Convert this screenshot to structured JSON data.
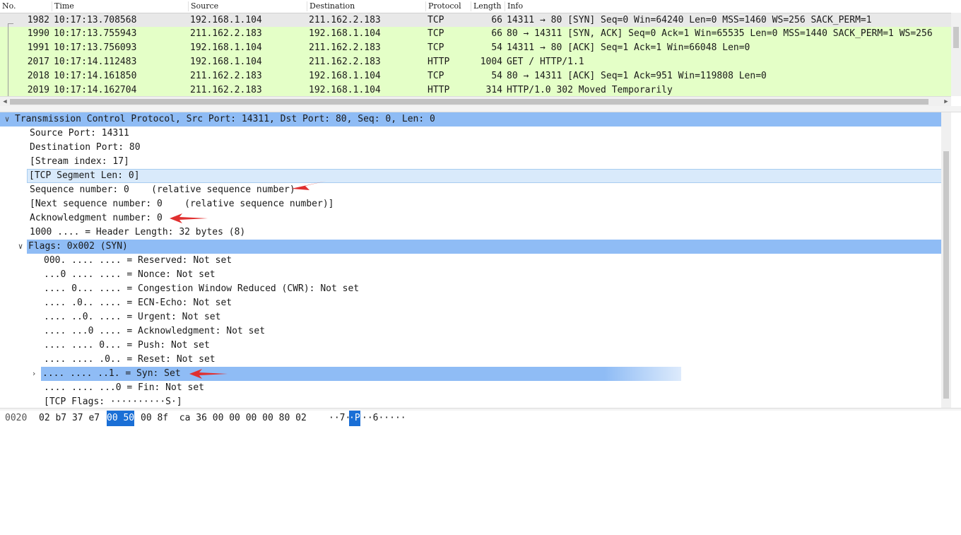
{
  "columns": {
    "no": "No.",
    "time": "Time",
    "source": "Source",
    "destination": "Destination",
    "protocol": "Protocol",
    "length": "Length",
    "info": "Info"
  },
  "packets": [
    {
      "no": "1982",
      "time": "10:17:13.708568",
      "source": "192.168.1.104",
      "destination": "211.162.2.183",
      "protocol": "TCP",
      "length": "66",
      "info": "14311 → 80 [SYN] Seq=0 Win=64240 Len=0 MSS=1460 WS=256 SACK_PERM=1"
    },
    {
      "no": "1990",
      "time": "10:17:13.755943",
      "source": "211.162.2.183",
      "destination": "192.168.1.104",
      "protocol": "TCP",
      "length": "66",
      "info": "80 → 14311 [SYN, ACK] Seq=0 Ack=1 Win=65535 Len=0 MSS=1440 SACK_PERM=1 WS=256"
    },
    {
      "no": "1991",
      "time": "10:17:13.756093",
      "source": "192.168.1.104",
      "destination": "211.162.2.183",
      "protocol": "TCP",
      "length": "54",
      "info": "14311 → 80 [ACK] Seq=1 Ack=1 Win=66048 Len=0"
    },
    {
      "no": "2017",
      "time": "10:17:14.112483",
      "source": "192.168.1.104",
      "destination": "211.162.2.183",
      "protocol": "HTTP",
      "length": "1004",
      "info": "GET / HTTP/1.1"
    },
    {
      "no": "2018",
      "time": "10:17:14.161850",
      "source": "211.162.2.183",
      "destination": "192.168.1.104",
      "protocol": "TCP",
      "length": "54",
      "info": "80 → 14311 [ACK] Seq=1 Ack=951 Win=119808 Len=0"
    },
    {
      "no": "2019",
      "time": "10:17:14.162704",
      "source": "211.162.2.183",
      "destination": "192.168.1.104",
      "protocol": "HTTP",
      "length": "314",
      "info": "HTTP/1.0 302 Moved Temporarily"
    }
  ],
  "tree": {
    "tcp_header": "Transmission Control Protocol, Src Port: 14311, Dst Port: 80, Seq: 0, Len: 0",
    "source_port": "Source Port: 14311",
    "dest_port": "Destination Port: 80",
    "stream_index": "[Stream index: 17]",
    "segment_len": "[TCP Segment Len: 0]",
    "seq_number": "Sequence number: 0    (relative sequence number)",
    "next_seq": "[Next sequence number: 0    (relative sequence number)]",
    "ack_number": "Acknowledgment number: 0",
    "header_length": "1000 .... = Header Length: 32 bytes (8)",
    "flags": "Flags: 0x002 (SYN)",
    "flag_reserved": "000. .... .... = Reserved: Not set",
    "flag_nonce": "...0 .... .... = Nonce: Not set",
    "flag_cwr": ".... 0... .... = Congestion Window Reduced (CWR): Not set",
    "flag_ecn": ".... .0.. .... = ECN-Echo: Not set",
    "flag_urgent": ".... ..0. .... = Urgent: Not set",
    "flag_ack": ".... ...0 .... = Acknowledgment: Not set",
    "flag_push": ".... .... 0... = Push: Not set",
    "flag_reset": ".... .... .0.. = Reset: Not set",
    "flag_syn": ".... .... ..1. = Syn: Set",
    "flag_fin": ".... .... ...0 = Fin: Not set",
    "tcp_flags": "[TCP Flags: ··········S·]"
  },
  "bytes": {
    "offset": "0020",
    "hex_before": "02 b7 37 e7",
    "hex_selected": "00 50",
    "hex_after": "00 8f  ca 36 00 00 00 00 80 02",
    "ascii_before": "··7·",
    "ascii_selected": "·P",
    "ascii_after": "··6·····"
  },
  "colors": {
    "tcp_row": "#e4ffc7",
    "selection": "#8fbcf5",
    "annotation_arrow": "#e03030"
  }
}
